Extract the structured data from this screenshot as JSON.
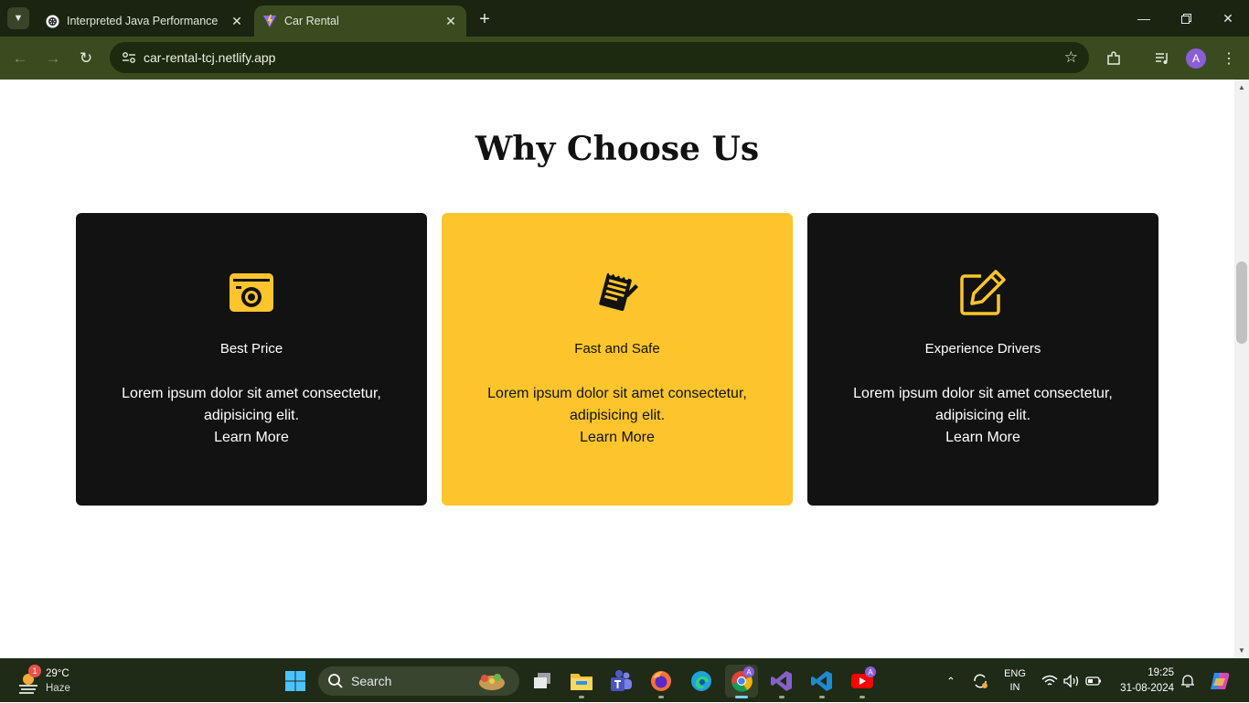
{
  "browser": {
    "tabs": [
      {
        "title": "Interpreted Java Performance",
        "active": false
      },
      {
        "title": "Car Rental",
        "active": true
      }
    ],
    "url": "car-rental-tcj.netlify.app",
    "profile_initial": "A"
  },
  "page": {
    "heading": "Why Choose Us",
    "cards": [
      {
        "title": "Best Price",
        "description": "Lorem ipsum dolor sit amet consectetur, adipisicing elit.",
        "link": "Learn More",
        "icon": "camera-icon",
        "theme": "dark"
      },
      {
        "title": "Fast and Safe",
        "description": "Lorem ipsum dolor sit amet consectetur, adipisicing elit.",
        "link": "Learn More",
        "icon": "notepad-pencil-icon",
        "theme": "yellow"
      },
      {
        "title": "Experience Drivers",
        "description": "Lorem ipsum dolor sit amet consectetur, adipisicing elit.",
        "link": "Learn More",
        "icon": "edit-square-icon",
        "theme": "dark"
      }
    ],
    "colors": {
      "accent": "#fdc52b",
      "card_dark": "#121212"
    }
  },
  "taskbar": {
    "weather": {
      "temp": "29°C",
      "condition": "Haze",
      "badge": "1"
    },
    "search_label": "Search",
    "language": {
      "line1": "ENG",
      "line2": "IN"
    },
    "time": "19:25",
    "date": "31-08-2024"
  }
}
